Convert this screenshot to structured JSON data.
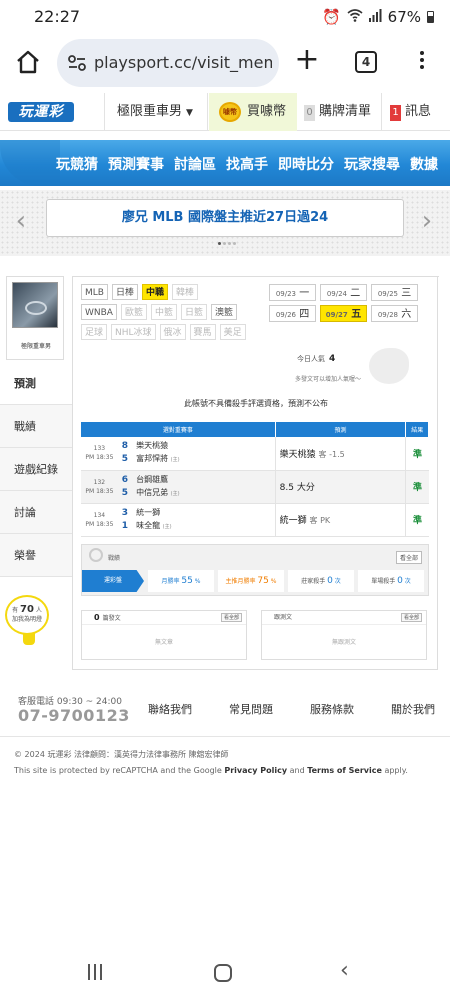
{
  "status": {
    "time": "22:27",
    "battery": "67%"
  },
  "browser": {
    "url": "playsport.cc/visit_mem",
    "tab_count": "4"
  },
  "header": {
    "logo": "玩運彩",
    "user_select": "極限重車男",
    "coin": "買噱幣",
    "coin_icon_text": "噱幣",
    "cart_count": "0",
    "cart": "購牌清單",
    "msg_count": "1",
    "msg": "訊息"
  },
  "nav": {
    "items": [
      "玩競猜",
      "預測賽事",
      "討論區",
      "找高手",
      "即時比分",
      "玩家搜尋",
      "數據"
    ]
  },
  "banner": {
    "text": "廖兄 MLB 國際盤主推近27日過24"
  },
  "profile": {
    "name": "極限重車男"
  },
  "sidemenu": {
    "items": [
      "預測",
      "戰績",
      "遊戲紀錄",
      "討論",
      "榮譽"
    ]
  },
  "bulb": {
    "prefix": "有",
    "count": "70",
    "unit": "人",
    "label": "加我為明燈"
  },
  "sports": {
    "row1": [
      {
        "label": "MLB",
        "state": "normal"
      },
      {
        "label": "日棒",
        "state": "normal"
      },
      {
        "label": "中職",
        "state": "selected"
      },
      {
        "label": "韓棒",
        "state": "off"
      }
    ],
    "row2": [
      {
        "label": "WNBA",
        "state": "normal"
      },
      {
        "label": "歐籃",
        "state": "off"
      },
      {
        "label": "中籃",
        "state": "off"
      },
      {
        "label": "日籃",
        "state": "off"
      },
      {
        "label": "澳籃",
        "state": "normal"
      }
    ],
    "row3": [
      {
        "label": "足球",
        "state": "off"
      },
      {
        "label": "NHL冰球",
        "state": "off"
      },
      {
        "label": "俄冰",
        "state": "off"
      },
      {
        "label": "賽馬",
        "state": "off"
      },
      {
        "label": "美足",
        "state": "off"
      }
    ]
  },
  "dates": [
    {
      "date": "09/23",
      "day": "一",
      "selected": false
    },
    {
      "date": "09/24",
      "day": "二",
      "selected": false
    },
    {
      "date": "09/25",
      "day": "三",
      "selected": false
    },
    {
      "date": "09/26",
      "day": "四",
      "selected": false
    },
    {
      "date": "09/27",
      "day": "五",
      "selected": true
    },
    {
      "date": "09/28",
      "day": "六",
      "selected": false
    }
  ],
  "popularity": {
    "label": "今日人氣",
    "value": "4",
    "tip": "多發文可以增加人氣喔～"
  },
  "notice": "此帳號不具備殺手評選資格，預測不公布",
  "table": {
    "headers": [
      "選對重賽事",
      "預測",
      "結果"
    ],
    "rows": [
      {
        "id": "133",
        "time": "PM 18:35",
        "score_a": "8",
        "score_b": "5",
        "team_a": "樂天桃猿",
        "team_b": "富邦悍將",
        "home_tag": "(主)",
        "pick": "樂天桃猿",
        "pick_extra": "客 -1.5",
        "result": "準"
      },
      {
        "id": "132",
        "time": "PM 18:35",
        "score_a": "6",
        "score_b": "5",
        "team_a": "台鋼雄鷹",
        "team_b": "中信兄弟",
        "home_tag": "(主)",
        "pick": "8.5 大分",
        "pick_extra": "",
        "result": "準"
      },
      {
        "id": "134",
        "time": "PM 18:35",
        "score_a": "3",
        "score_b": "1",
        "team_a": "統一獅",
        "team_b": "味全龍",
        "home_tag": "(主)",
        "pick": "統一獅",
        "pick_extra": "客 PK",
        "result": "準"
      }
    ]
  },
  "stats": {
    "label": "戰績",
    "all_button": "看全部",
    "tag": "運彩盤",
    "monthly_win_label": "月勝率",
    "monthly_win": "55",
    "home_win_label": "主推月勝率",
    "home_win": "75",
    "pct": "%",
    "away_killer_label": "莊家殺手",
    "away_killer": "0",
    "single_killer_label": "單場殺手",
    "single_killer": "0",
    "times": "次"
  },
  "posts": {
    "count": "0",
    "label": "篇發文",
    "more": "看全部",
    "empty": "無文章"
  },
  "replies": {
    "label": "跟測文",
    "more": "看全部",
    "empty": "無跟測文"
  },
  "footer": {
    "hotline_label": "客服電話 09:30 ~ 24:00",
    "hotline": "07-9700123",
    "links": [
      "聯絡我們",
      "常見問題",
      "服務條款",
      "關於我們"
    ],
    "copyright": "© 2024 玩運彩 法律顧問：漢英得力法律事務所 陳舘宏律師",
    "recaptcha_pre": "This site is protected by reCAPTCHA and the Google ",
    "privacy": "Privacy Policy",
    "and": " and ",
    "terms": "Terms of Service",
    "recaptcha_post": " apply."
  }
}
